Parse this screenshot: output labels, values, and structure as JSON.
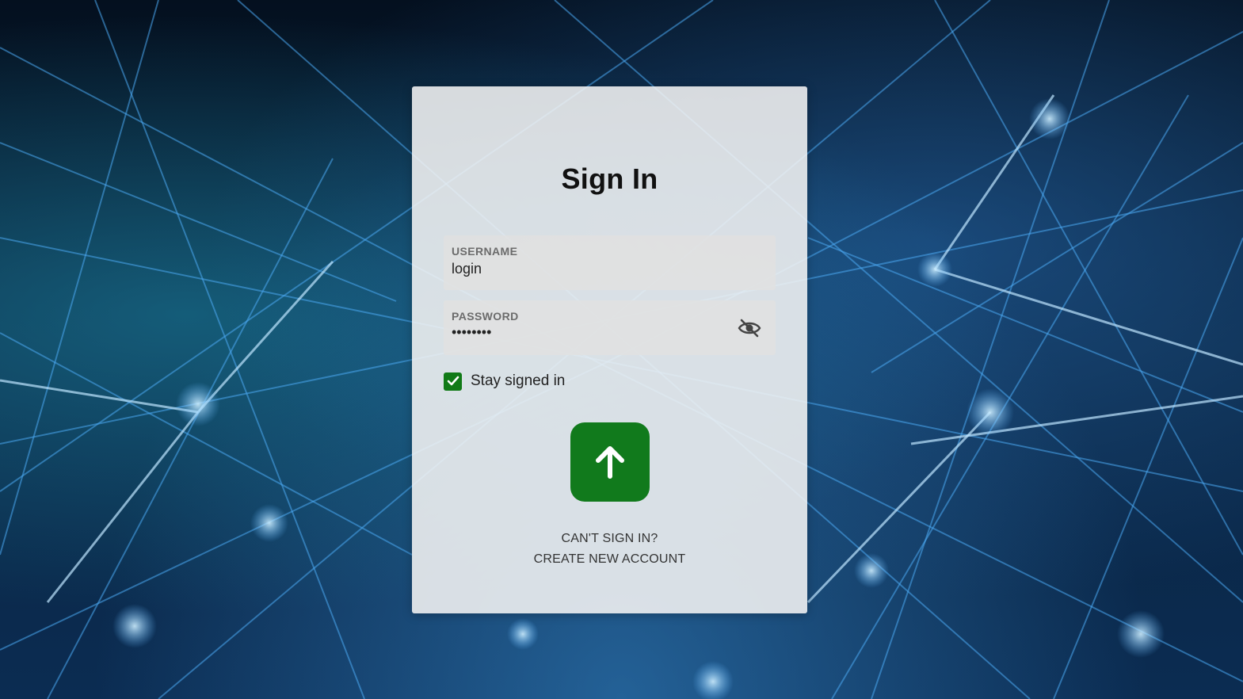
{
  "background": {
    "icon": "network-lines-city-photo",
    "accent_color": "#2f8fe0"
  },
  "signin": {
    "title": "Sign In",
    "username": {
      "label": "USERNAME",
      "value": "login"
    },
    "password": {
      "label": "PASSWORD",
      "masked_value": "••••••••",
      "toggle_icon": "eye-off-icon"
    },
    "stay_signed_in": {
      "label": "Stay signed in",
      "checked": true
    },
    "submit_icon": "arrow-up-icon",
    "submit_color": "#117a1c",
    "cant_sign_in": "CAN'T SIGN IN?",
    "create_account": "CREATE NEW ACCOUNT"
  }
}
